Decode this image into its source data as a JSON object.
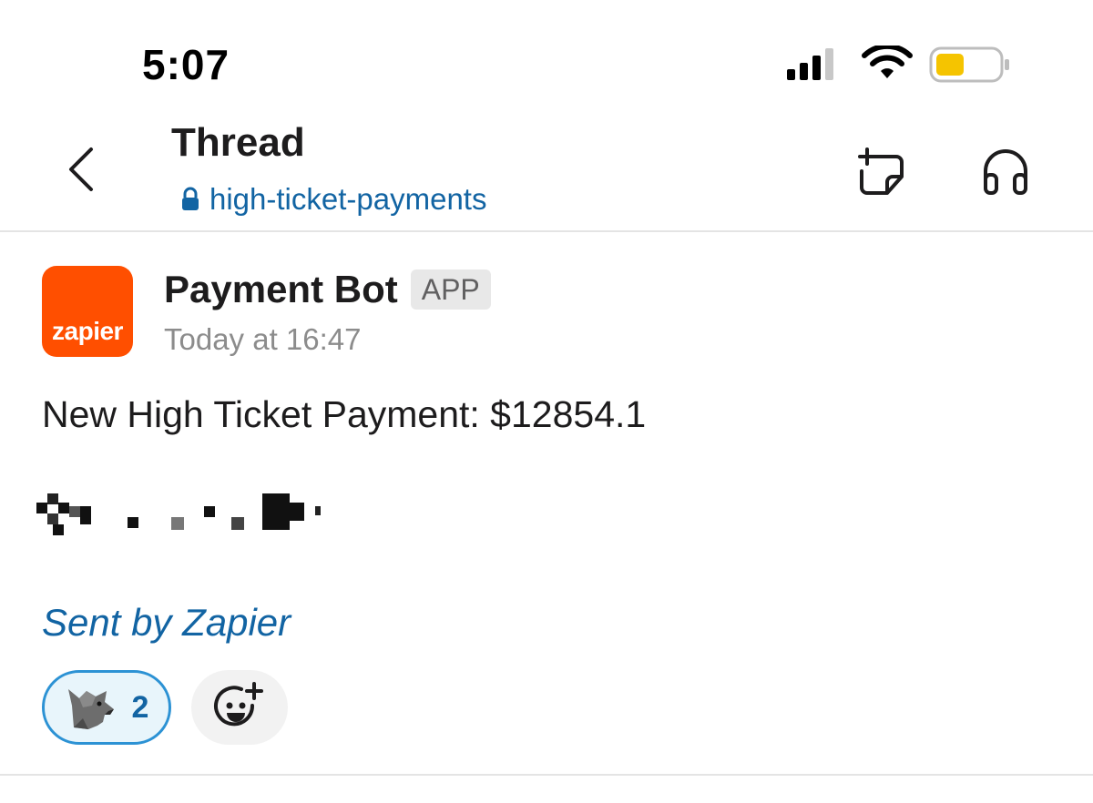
{
  "status_bar": {
    "time": "5:07",
    "icons": [
      "cellular-signal-icon",
      "wifi-icon",
      "battery-icon"
    ],
    "battery_color": "#f5c400"
  },
  "header": {
    "title": "Thread",
    "channel": "high-ticket-payments",
    "icons": [
      "back-chevron-icon",
      "lock-icon",
      "new-note-icon",
      "headphones-icon"
    ]
  },
  "message": {
    "avatar_text": "zapier",
    "avatar_color": "#ff4f00",
    "sender": "Payment Bot",
    "badge": "APP",
    "timestamp": "Today at 16:47",
    "text": "New High Ticket Payment: $12854.1",
    "sent_by": "Sent by Zapier",
    "reactions": [
      {
        "emoji": "wolf-icon",
        "count": "2"
      }
    ],
    "add_reaction_icon": "add-reaction-icon"
  },
  "colors": {
    "link": "#1264a3",
    "reaction_border": "#2c92d4",
    "reaction_bg": "#e8f5fb"
  }
}
